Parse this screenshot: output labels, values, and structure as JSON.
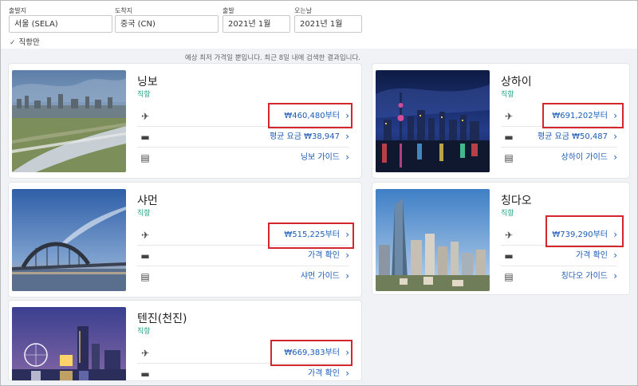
{
  "search": {
    "origin": {
      "label": "출발지",
      "value": "서울 (SELA)"
    },
    "destination": {
      "label": "도착지",
      "value": "중국 (CN)"
    },
    "depart": {
      "label": "출발",
      "value": "2021년 1월"
    },
    "return": {
      "label": "오는날",
      "value": "2021년 1월"
    },
    "direct_only": "직항만"
  },
  "note": "예상 최저 가격일 뿐입니다. 최근 8일 내에 검색한 결과입니다.",
  "cards": {
    "ningbo": {
      "city": "닝보",
      "sub": "직항",
      "price": "₩460,480부터",
      "hotel": "평균 요금 ₩38,947",
      "guide": "닝보 가이드"
    },
    "shanghai": {
      "city": "상하이",
      "sub": "직항",
      "price": "₩691,202부터",
      "hotel": "평균 요금 ₩50,487",
      "guide": "상하이 가이드"
    },
    "xiamen": {
      "city": "샤먼",
      "sub": "직항",
      "price": "₩515,225부터",
      "hotel": "가격 확인",
      "guide": "샤먼 가이드"
    },
    "qingdao": {
      "city": "칭다오",
      "sub": "직항",
      "price": "₩739,290부터",
      "hotel": "가격 확인",
      "guide": "칭다오 가이드"
    },
    "tianjin": {
      "city": "텐진(천진)",
      "sub": "직항",
      "price": "₩669,383부터",
      "hotel": "가격 확인"
    }
  },
  "colors": {
    "link": "#1b5bb5",
    "direct": "#1aa186",
    "highlight": "#d4262d"
  },
  "icons": {
    "flight": "airplane-icon",
    "hotel": "bed-icon",
    "guide": "book-icon",
    "more": "chevron-right-icon",
    "check": "check-icon"
  }
}
